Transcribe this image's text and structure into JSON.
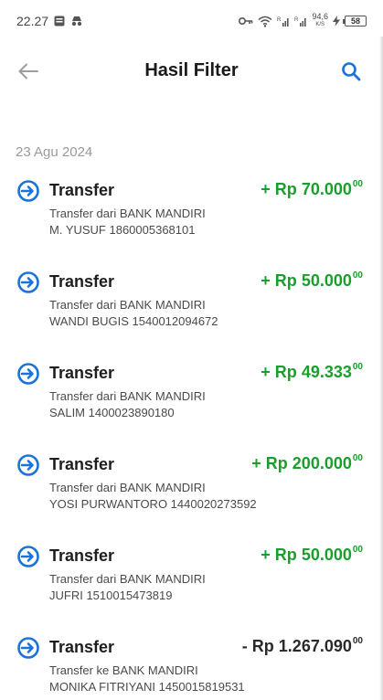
{
  "status_bar": {
    "time": "22.27",
    "battery": "58",
    "net_speed_value": "94,6",
    "net_speed_unit": "K/S",
    "signal_label": "R"
  },
  "app_bar": {
    "title": "Hasil Filter"
  },
  "date_header": "23 Agu 2024",
  "transactions": [
    {
      "type": "Transfer",
      "sign": "+",
      "currency": "Rp",
      "amount": "70.000",
      "cents": "00",
      "direction": "credit",
      "line1": "Transfer dari BANK MANDIRI",
      "line2": "M. YUSUF 1860005368101"
    },
    {
      "type": "Transfer",
      "sign": "+",
      "currency": "Rp",
      "amount": "50.000",
      "cents": "00",
      "direction": "credit",
      "line1": "Transfer dari BANK MANDIRI",
      "line2": "WANDI BUGIS 1540012094672"
    },
    {
      "type": "Transfer",
      "sign": "+",
      "currency": "Rp",
      "amount": "49.333",
      "cents": "00",
      "direction": "credit",
      "line1": "Transfer dari BANK MANDIRI",
      "line2": "SALIM 1400023890180"
    },
    {
      "type": "Transfer",
      "sign": "+",
      "currency": "Rp",
      "amount": "200.000",
      "cents": "00",
      "direction": "credit",
      "line1": "Transfer dari BANK MANDIRI",
      "line2": "YOSI PURWANTORO 1440020273592"
    },
    {
      "type": "Transfer",
      "sign": "+",
      "currency": "Rp",
      "amount": "50.000",
      "cents": "00",
      "direction": "credit",
      "line1": "Transfer dari BANK MANDIRI",
      "line2": "JUFRI 1510015473819"
    },
    {
      "type": "Transfer",
      "sign": "-",
      "currency": "Rp",
      "amount": "1.267.090",
      "cents": "00",
      "direction": "debit",
      "line1": "Transfer ke BANK MANDIRI",
      "line2": "MONIKA FITRIYANI 1450015819531"
    }
  ],
  "colors": {
    "credit": "#1a9e2c",
    "debit": "#2a2a2a",
    "accent": "#1a73d9",
    "muted": "#9a9a9a"
  },
  "icons": {
    "back": "arrow-left-icon",
    "search": "search-icon",
    "transfer": "transfer-in-circle-icon"
  }
}
